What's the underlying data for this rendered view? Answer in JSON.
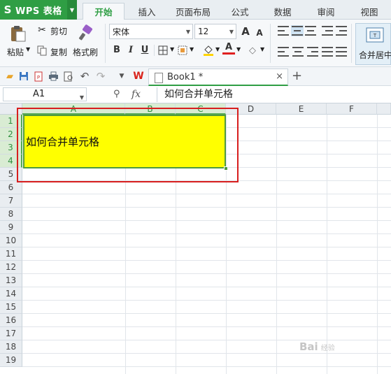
{
  "app": {
    "title": "WPS 表格",
    "logo": "S"
  },
  "menu_tabs": [
    {
      "label": "开始",
      "active": true
    },
    {
      "label": "插入"
    },
    {
      "label": "页面布局"
    },
    {
      "label": "公式"
    },
    {
      "label": "数据"
    },
    {
      "label": "审阅"
    },
    {
      "label": "视图"
    }
  ],
  "ribbon": {
    "paste_label": "粘贴",
    "cut_label": "剪切",
    "copy_label": "复制",
    "format_painter_label": "格式刷",
    "font_name": "宋体",
    "font_size": "12",
    "bold": "B",
    "italic": "I",
    "underline": "U",
    "font_color_glyph": "A",
    "grow_font": "A",
    "shrink_font": "A",
    "merge_center_label": "合并居中"
  },
  "quick_bar": {
    "app_icon_label": "W",
    "document_tab": "Book1 *",
    "close_glyph": "×",
    "new_tab_glyph": "+"
  },
  "formula_bar": {
    "cell_ref": "A1",
    "fx_label": "fx",
    "content": "如何合并单元格"
  },
  "sheet": {
    "columns": [
      "A",
      "B",
      "C",
      "D",
      "E",
      "F"
    ],
    "rows": [
      "1",
      "2",
      "3",
      "4",
      "5",
      "6",
      "7",
      "8",
      "9",
      "10",
      "11",
      "12",
      "13",
      "14",
      "15",
      "16",
      "17",
      "18",
      "19"
    ],
    "merged_cell_text": "如何合并单元格",
    "merged_range": "A1:C4",
    "merged_fill": "#ffff00"
  },
  "colors": {
    "accent_green": "#2f9e44",
    "highlight_red": "#d81e1e"
  },
  "watermark": {
    "text": "Bai",
    "sub": "经验"
  }
}
